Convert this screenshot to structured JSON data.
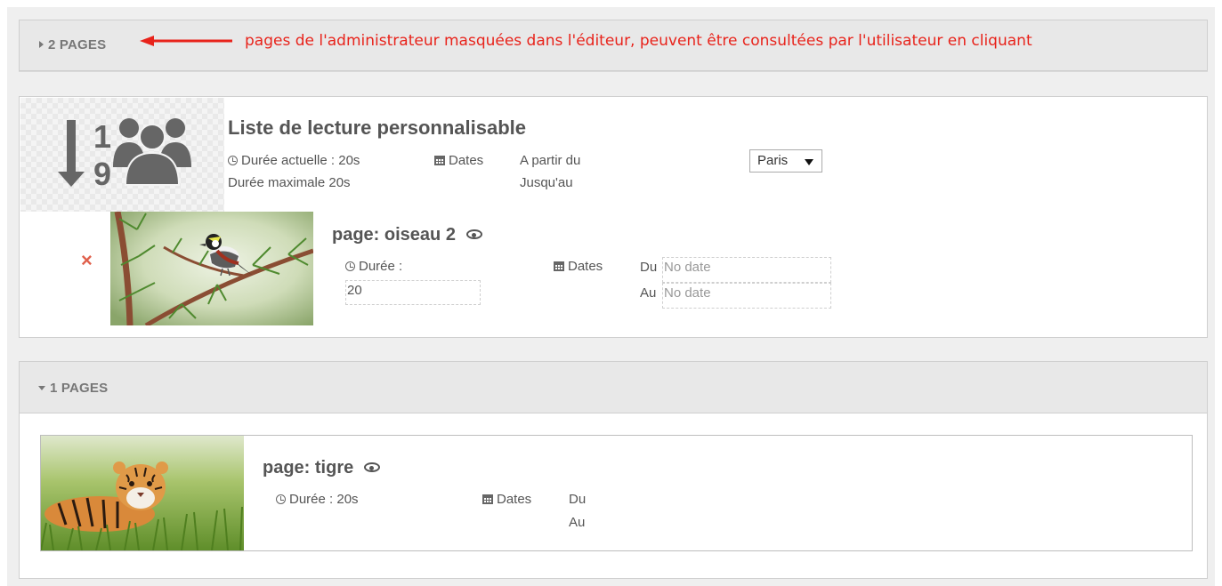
{
  "collapsed_group": {
    "label": "2 PAGES"
  },
  "annotation": {
    "text": "pages de l'administrateur masquées dans l'éditeur, peuvent être consultées par l'utilisateur en cliquant",
    "color": "#e8231b"
  },
  "playlist": {
    "icon_digits": [
      "1",
      "9"
    ],
    "title": "Liste de lecture personnalisable",
    "current_duration": "Durée actuelle : 20s",
    "max_duration": "Durée maximale 20s",
    "dates_label": "Dates",
    "from_label": "A partir du",
    "until_label": "Jusqu'au",
    "city_select": "Paris"
  },
  "playlist_page": {
    "title": "page: oiseau 2",
    "duration_label": "Durée :",
    "duration_value": "20",
    "dates_label": "Dates",
    "du_label": "Du",
    "au_label": "Au",
    "du_value": "No date",
    "au_value": "No date"
  },
  "expanded_group": {
    "label": "1 PAGES",
    "page": {
      "title": "page: tigre",
      "duration": "Durée : 20s",
      "dates_label": "Dates",
      "du_label": "Du",
      "au_label": "Au"
    }
  }
}
